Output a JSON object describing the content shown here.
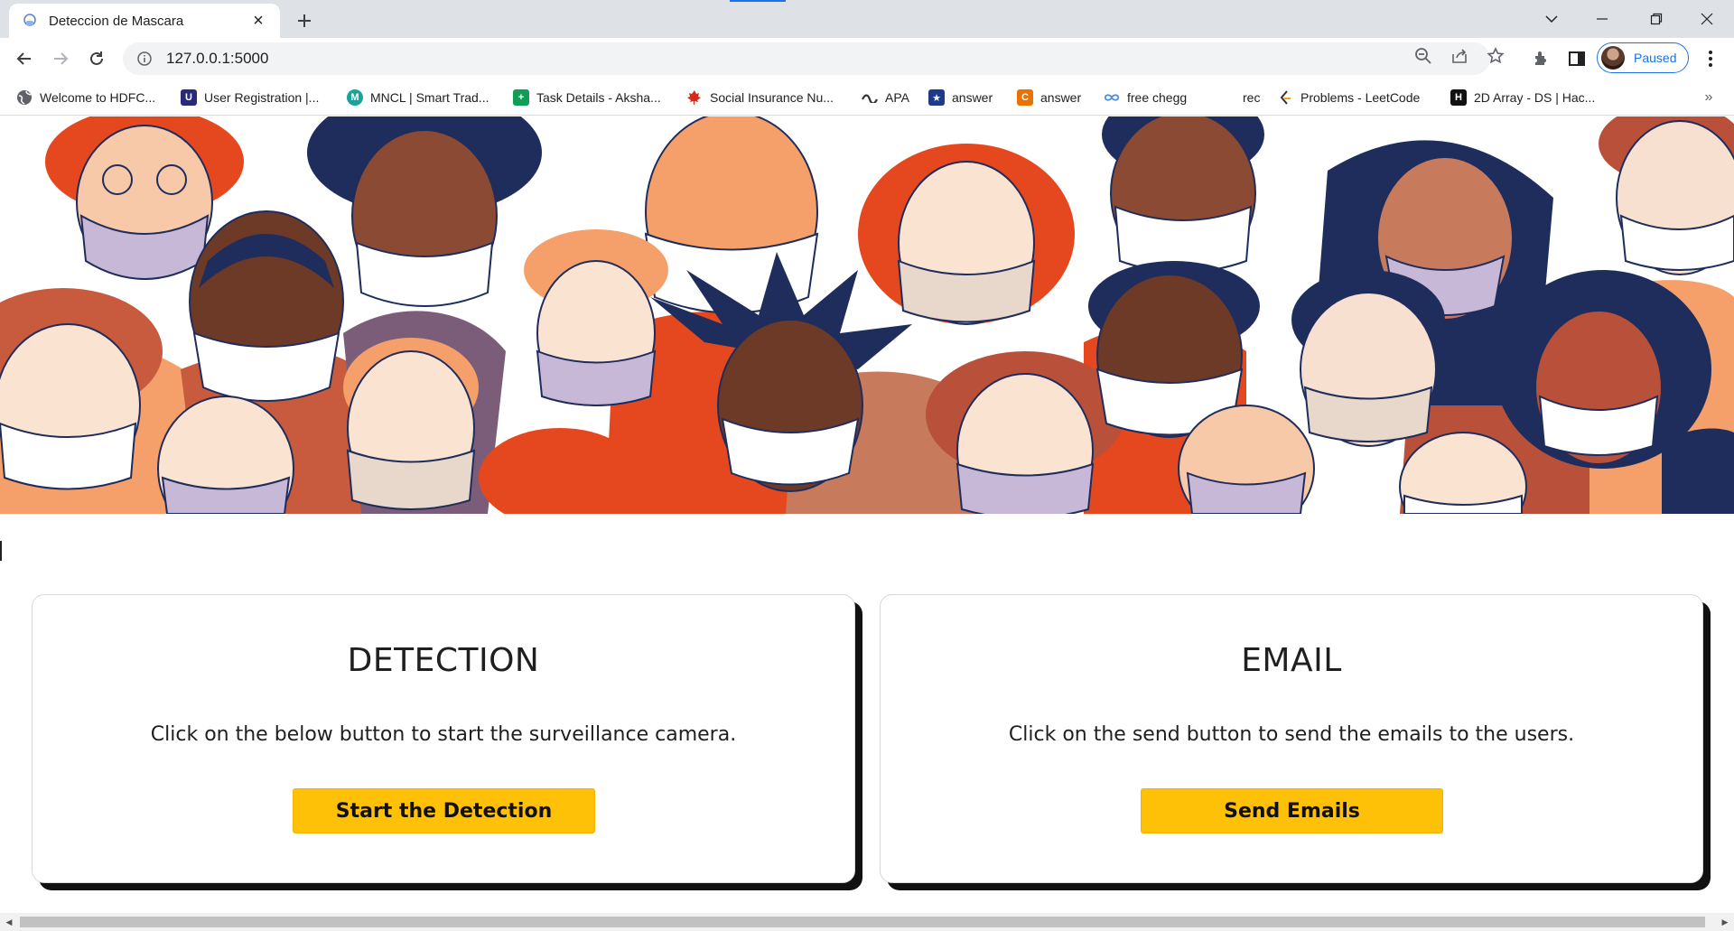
{
  "colors": {
    "accent": "#1a73e8",
    "button": "#ffc107",
    "orange": "#e5481f",
    "navy": "#1f2d5c",
    "peach": "#f5a06a"
  },
  "tab": {
    "title": "Deteccion de Mascara",
    "favicon": "mask-favicon-icon",
    "close": "×"
  },
  "toolbar": {
    "url": "127.0.0.1:5000",
    "profile_label": "Paused"
  },
  "bookmarks": [
    {
      "label": "Welcome to HDFC...",
      "icon": "globe-icon",
      "color": "#5f6368"
    },
    {
      "label": "User Registration |...",
      "icon": "registration-icon",
      "color": "#2a2a7a"
    },
    {
      "label": "MNCL | Smart Trad...",
      "icon": "mncl-icon",
      "color": "#1aa39a"
    },
    {
      "label": "Task Details - Aksha...",
      "icon": "sheets-icon",
      "color": "#0f9d58"
    },
    {
      "label": "Social Insurance Nu...",
      "icon": "maple-leaf-icon",
      "color": "#d52b1e"
    },
    {
      "label": "APA",
      "icon": "apa-icon",
      "color": "#333333"
    },
    {
      "label": "answer",
      "icon": "star-badge-icon",
      "color": "#1e3a8a"
    },
    {
      "label": "answer",
      "icon": "chegg-c-icon",
      "color": "#eb7100"
    },
    {
      "label": "free chegg",
      "icon": "infinity-icon",
      "color": "#4a90e2"
    },
    {
      "label": "rec",
      "icon": "blank-icon",
      "color": "#ffffff"
    },
    {
      "label": "Problems - LeetCode",
      "icon": "leetcode-icon",
      "color": "#ffa116"
    },
    {
      "label": "2D Array - DS | Hac...",
      "icon": "hackerrank-icon",
      "color": "#111111"
    }
  ],
  "bookmarks_more": "»",
  "cards": [
    {
      "title": "DETECTION",
      "description": "Click on the below button to start the surveillance camera.",
      "button": "Start the Detection"
    },
    {
      "title": "EMAIL",
      "description": "Click on the send button to send the emails to the users.",
      "button": "Send Emails"
    }
  ],
  "hero": {
    "image": "masked-people-illustration"
  }
}
